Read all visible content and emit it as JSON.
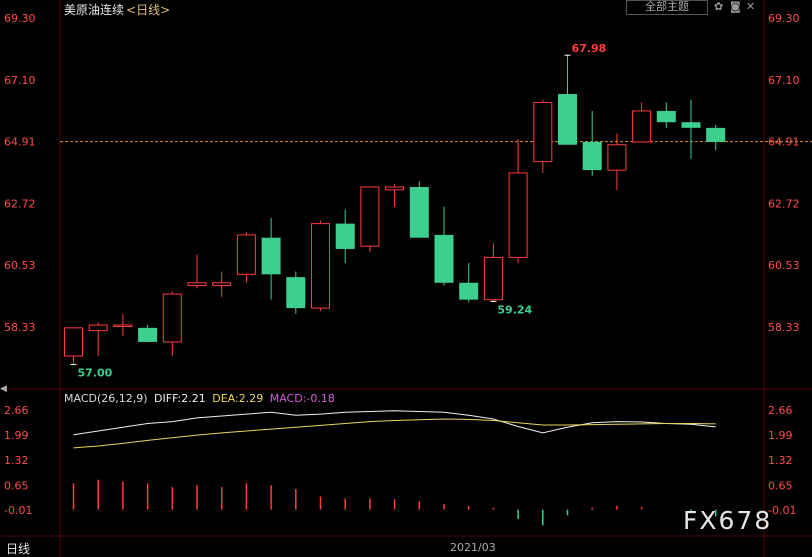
{
  "header": {
    "instrument": "美原油连续",
    "period": "<日线>",
    "theme_button": "全部主题",
    "icons": [
      "gear-icon",
      "camera-icon",
      "close-icon"
    ]
  },
  "colors": {
    "up": "#ff3b3b",
    "down": "#3ccf8e",
    "axis_text": "#ff4b4b",
    "grid": "#3a0000",
    "last_price_line": "#e08a3c",
    "diff_line": "#f0f0f0",
    "dea_line": "#e6d85c",
    "macd_label": "#d060d0"
  },
  "chart_data": [
    {
      "type": "candlestick",
      "ylim": [
        57.5,
        69.3
      ],
      "y_ticks": [
        "69.30",
        "67.10",
        "64.91",
        "62.72",
        "60.53",
        "58.33"
      ],
      "current_price_line": 64.91,
      "annotations": [
        {
          "label": "67.98",
          "index": 20,
          "kind": "high"
        },
        {
          "label": "59.24",
          "index": 17,
          "kind": "low"
        },
        {
          "label": "57.00",
          "index": 0,
          "kind": "low"
        }
      ],
      "candles": [
        {
          "o": 57.3,
          "h": 58.1,
          "l": 57.0,
          "c": 58.3
        },
        {
          "o": 58.2,
          "h": 58.5,
          "l": 57.3,
          "c": 58.4
        },
        {
          "o": 58.4,
          "h": 58.8,
          "l": 58.0,
          "c": 58.4
        },
        {
          "o": 58.3,
          "h": 58.4,
          "l": 57.8,
          "c": 57.8
        },
        {
          "o": 57.8,
          "h": 59.6,
          "l": 57.3,
          "c": 59.5
        },
        {
          "o": 59.8,
          "h": 60.9,
          "l": 59.7,
          "c": 59.9
        },
        {
          "o": 59.8,
          "h": 60.3,
          "l": 59.4,
          "c": 59.9
        },
        {
          "o": 60.2,
          "h": 61.7,
          "l": 59.9,
          "c": 61.6
        },
        {
          "o": 61.5,
          "h": 62.2,
          "l": 59.3,
          "c": 60.2
        },
        {
          "o": 60.1,
          "h": 60.3,
          "l": 58.8,
          "c": 59.0
        },
        {
          "o": 59.0,
          "h": 62.1,
          "l": 58.9,
          "c": 62.0
        },
        {
          "o": 62.0,
          "h": 62.5,
          "l": 60.6,
          "c": 61.1
        },
        {
          "o": 61.2,
          "h": 63.3,
          "l": 61.0,
          "c": 63.3
        },
        {
          "o": 63.2,
          "h": 63.4,
          "l": 62.6,
          "c": 63.3
        },
        {
          "o": 63.3,
          "h": 63.5,
          "l": 61.6,
          "c": 61.5
        },
        {
          "o": 61.6,
          "h": 62.6,
          "l": 59.8,
          "c": 59.9
        },
        {
          "o": 59.9,
          "h": 60.6,
          "l": 59.2,
          "c": 59.3
        },
        {
          "o": 59.3,
          "h": 61.3,
          "l": 59.24,
          "c": 60.8
        },
        {
          "o": 60.8,
          "h": 65.0,
          "l": 60.6,
          "c": 63.8
        },
        {
          "o": 64.2,
          "h": 66.4,
          "l": 63.8,
          "c": 66.3
        },
        {
          "o": 66.6,
          "h": 67.98,
          "l": 64.8,
          "c": 64.8
        },
        {
          "o": 64.9,
          "h": 66.0,
          "l": 63.7,
          "c": 63.9
        },
        {
          "o": 63.9,
          "h": 65.2,
          "l": 63.2,
          "c": 64.8
        },
        {
          "o": 64.9,
          "h": 66.3,
          "l": 64.9,
          "c": 66.0
        },
        {
          "o": 66.0,
          "h": 66.3,
          "l": 65.4,
          "c": 65.6
        },
        {
          "o": 65.6,
          "h": 66.4,
          "l": 64.3,
          "c": 65.4
        },
        {
          "o": 65.4,
          "h": 65.5,
          "l": 64.6,
          "c": 64.9
        }
      ]
    },
    {
      "type": "line",
      "title": "MACD(26,12,9)",
      "legend": [
        {
          "label": "DIFF:2.21",
          "color_key": "diff_line"
        },
        {
          "label": "DEA:2.29",
          "color_key": "dea_line"
        },
        {
          "label": "MACD:-0.18",
          "color_key": "macd_label"
        }
      ],
      "ylim": [
        -0.35,
        2.8
      ],
      "y_ticks": [
        "2.66",
        "1.99",
        "1.32",
        "0.65",
        "-0.01"
      ],
      "x_label": "2021/03",
      "series": [
        {
          "name": "DIFF",
          "values": [
            2.0,
            2.1,
            2.2,
            2.3,
            2.35,
            2.45,
            2.5,
            2.55,
            2.6,
            2.52,
            2.55,
            2.6,
            2.62,
            2.64,
            2.62,
            2.6,
            2.52,
            2.42,
            2.22,
            2.05,
            2.2,
            2.32,
            2.35,
            2.34,
            2.3,
            2.28,
            2.21
          ]
        },
        {
          "name": "DEA",
          "values": [
            1.65,
            1.7,
            1.77,
            1.85,
            1.92,
            1.99,
            2.05,
            2.1,
            2.15,
            2.2,
            2.25,
            2.3,
            2.35,
            2.38,
            2.4,
            2.42,
            2.41,
            2.38,
            2.32,
            2.26,
            2.26,
            2.27,
            2.28,
            2.29,
            2.3,
            2.3,
            2.29
          ]
        },
        {
          "name": "MACD",
          "values": [
            0.7,
            0.8,
            0.75,
            0.7,
            0.6,
            0.65,
            0.6,
            0.7,
            0.65,
            0.55,
            0.35,
            0.3,
            0.3,
            0.28,
            0.22,
            0.15,
            0.1,
            0.05,
            -0.25,
            -0.42,
            -0.15,
            0.05,
            0.1,
            0.06,
            0.0,
            -0.05,
            -0.18
          ]
        }
      ]
    }
  ],
  "bottom": {
    "period_tab": "日线",
    "watermark": "FX678"
  }
}
